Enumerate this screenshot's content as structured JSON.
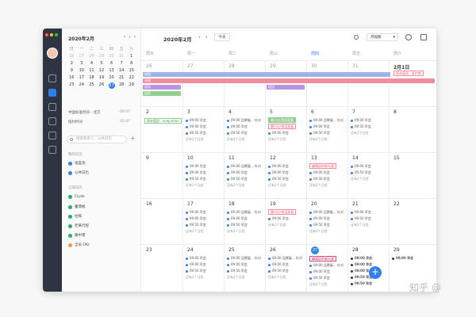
{
  "mini_calendar": {
    "title": "2020年2月",
    "nav": [
      "‹",
      "›",
      "‹"
    ],
    "weekdays": [
      "日",
      "一",
      "二",
      "三",
      "四",
      "五",
      "六"
    ],
    "days": [
      [
        "26",
        "27",
        "28",
        "29",
        "30",
        "31",
        "1"
      ],
      [
        "2",
        "3",
        "4",
        "5",
        "6",
        "7",
        "8"
      ],
      [
        "9",
        "10",
        "11",
        "12",
        "13",
        "14",
        "15"
      ],
      [
        "16",
        "17",
        "18",
        "19",
        "20",
        "21",
        "22"
      ],
      [
        "23",
        "24",
        "25",
        "26",
        "27",
        "28",
        "29"
      ]
    ]
  },
  "timezones": [
    {
      "label": "中国标准时间 - 北京",
      "time": "09:47"
    },
    {
      "label": "纽约时间",
      "time": "20:47"
    }
  ],
  "search_placeholder": "搜索联系人、公共日历",
  "my_calendars_title": "我的日历",
  "my_calendars": [
    {
      "name": "张昊浩",
      "color": "#2f80ed"
    },
    {
      "name": "公共日历",
      "color": "#2f80ed"
    }
  ],
  "subscribed_title": "订阅日历",
  "subscribed": [
    {
      "name": "Clyde",
      "color": "#27ae60"
    },
    {
      "name": "董博帆",
      "color": "#27ae60"
    },
    {
      "name": "杜梓",
      "color": "#27ae60"
    },
    {
      "name": "老黄行程",
      "color": "#27ae60"
    },
    {
      "name": "路中南",
      "color": "#27ae60"
    },
    {
      "name": "全员 OKr",
      "color": "#f2994a"
    }
  ],
  "topbar": {
    "title": "2020年2月",
    "today": "今天",
    "view": "月视图"
  },
  "week_headers": [
    "周日",
    "周一",
    "周二",
    "周三",
    "周四",
    "周五",
    "周六"
  ],
  "rows": [
    [
      "26",
      "27",
      "28",
      "29",
      "30",
      "31",
      "2月1日"
    ],
    [
      "2",
      "3",
      "4",
      "5",
      "6",
      "7",
      "8"
    ],
    [
      "9",
      "10",
      "11",
      "12",
      "13",
      "14",
      "15"
    ],
    [
      "16",
      "17",
      "18",
      "19",
      "20",
      "21",
      "22"
    ],
    [
      "23",
      "24",
      "25",
      "26",
      "27",
      "28",
      "29"
    ]
  ],
  "events": {
    "bar1": "休假",
    "bar2": "休假",
    "sub1": "值班",
    "sub2": "值班",
    "sub3": "值班",
    "sat_tag": "周末值班 · 张中南",
    "sun_tag": "周末值班 · xuejunhan",
    "morning": "09:00 早会",
    "morning2": "09:50 早会",
    "review": "09:00 品牌展... 针对",
    "more": "还有2个日程",
    "tag_a": "晨讨论/电话面板",
    "tag_b": "晨讨论/电话面板",
    "tag_c": "编辑部的新玩意",
    "tag_d": "编辑部的新玩意"
  },
  "fab_label": "+",
  "watermark": "知乎 @"
}
